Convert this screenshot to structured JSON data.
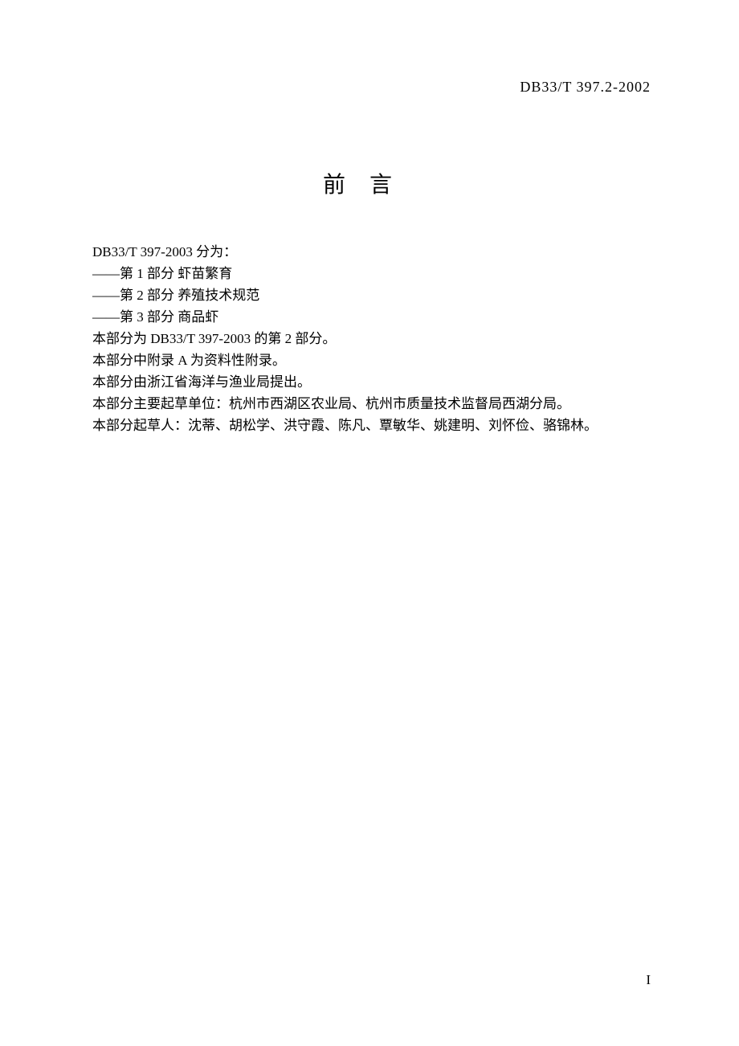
{
  "header": {
    "standard_code": "DB33/T 397.2-2002"
  },
  "title": "前言",
  "content": {
    "intro": "DB33/T 397-2003 分为：",
    "parts": [
      "——第 1 部分  虾苗繁育",
      "——第 2 部分  养殖技术规范",
      "——第 3 部分  商品虾"
    ],
    "lines": [
      "本部分为 DB33/T 397-2003 的第 2 部分。",
      "本部分中附录 A 为资料性附录。",
      "本部分由浙江省海洋与渔业局提出。",
      "本部分主要起草单位：杭州市西湖区农业局、杭州市质量技术监督局西湖分局。",
      "本部分起草人：沈蒂、胡松学、洪守霞、陈凡、覃敏华、姚建明、刘怀俭、骆锦林。"
    ]
  },
  "page_number": "I"
}
